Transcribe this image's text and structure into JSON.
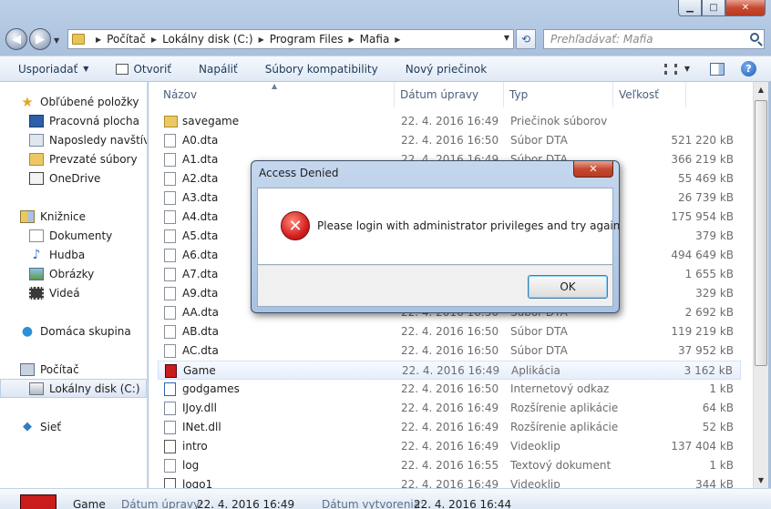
{
  "window": {
    "minimize": "▁",
    "maximize": "□",
    "close": "✕"
  },
  "address": {
    "crumbs": [
      "Počítač",
      "Lokálny disk (C:)",
      "Program Files",
      "Mafia"
    ],
    "search_placeholder": "Prehľadávať: Mafia"
  },
  "toolbar": {
    "organize": "Usporiadať",
    "open": "Otvoriť",
    "burn": "Napáliť",
    "compat": "Súbory kompatibility",
    "new_folder": "Nový priečinok"
  },
  "nav": {
    "favorites": "Obľúbené položky",
    "desktop": "Pracovná plocha",
    "recent": "Naposledy navštívené",
    "downloads": "Prevzaté súbory",
    "onedrive": "OneDrive",
    "libraries": "Knižnice",
    "documents": "Dokumenty",
    "music": "Hudba",
    "pictures": "Obrázky",
    "videos": "Videá",
    "homegroup": "Domáca skupina",
    "computer": "Počítač",
    "localdisk": "Lokálny disk (C:)",
    "network": "Sieť"
  },
  "columns": {
    "name": "Názov",
    "date": "Dátum úpravy",
    "type": "Typ",
    "size": "Veľkosť"
  },
  "files": [
    {
      "name": "savegame",
      "date": "22. 4. 2016 16:49",
      "type": "Priečinok súborov",
      "size": "",
      "icon": "folder"
    },
    {
      "name": "A0.dta",
      "date": "22. 4. 2016 16:50",
      "type": "Súbor DTA",
      "size": "521 220 kB",
      "icon": "dta"
    },
    {
      "name": "A1.dta",
      "date": "22. 4. 2016 16:49",
      "type": "Súbor DTA",
      "size": "366 219 kB",
      "icon": "dta"
    },
    {
      "name": "A2.dta",
      "date": "",
      "type": "",
      "size": "55 469 kB",
      "icon": "dta"
    },
    {
      "name": "A3.dta",
      "date": "",
      "type": "",
      "size": "26 739 kB",
      "icon": "dta"
    },
    {
      "name": "A4.dta",
      "date": "",
      "type": "",
      "size": "175 954 kB",
      "icon": "dta"
    },
    {
      "name": "A5.dta",
      "date": "",
      "type": "",
      "size": "379 kB",
      "icon": "dta"
    },
    {
      "name": "A6.dta",
      "date": "",
      "type": "",
      "size": "494 649 kB",
      "icon": "dta"
    },
    {
      "name": "A7.dta",
      "date": "",
      "type": "",
      "size": "1 655 kB",
      "icon": "dta"
    },
    {
      "name": "A9.dta",
      "date": "",
      "type": "",
      "size": "329 kB",
      "icon": "dta"
    },
    {
      "name": "AA.dta",
      "date": "22. 4. 2016 16:50",
      "type": "Súbor DTA",
      "size": "2 692 kB",
      "icon": "dta"
    },
    {
      "name": "AB.dta",
      "date": "22. 4. 2016 16:50",
      "type": "Súbor DTA",
      "size": "119 219 kB",
      "icon": "dta"
    },
    {
      "name": "AC.dta",
      "date": "22. 4. 2016 16:50",
      "type": "Súbor DTA",
      "size": "37 952 kB",
      "icon": "dta"
    },
    {
      "name": "Game",
      "date": "22. 4. 2016 16:49",
      "type": "Aplikácia",
      "size": "3 162 kB",
      "icon": "game"
    },
    {
      "name": "godgames",
      "date": "22. 4. 2016 16:50",
      "type": "Internetový odkaz",
      "size": "1 kB",
      "icon": "url"
    },
    {
      "name": "IJoy.dll",
      "date": "22. 4. 2016 16:49",
      "type": "Rozšírenie aplikácie",
      "size": "64 kB",
      "icon": "dll"
    },
    {
      "name": "INet.dll",
      "date": "22. 4. 2016 16:49",
      "type": "Rozšírenie aplikácie",
      "size": "52 kB",
      "icon": "dll"
    },
    {
      "name": "intro",
      "date": "22. 4. 2016 16:49",
      "type": "Videoklip",
      "size": "137 404 kB",
      "icon": "vid"
    },
    {
      "name": "log",
      "date": "22. 4. 2016 16:55",
      "type": "Textový dokument",
      "size": "1 kB",
      "icon": "txt"
    },
    {
      "name": "logo1",
      "date": "22. 4. 2016 16:49",
      "type": "Videoklip",
      "size": "344 kB",
      "icon": "vid"
    }
  ],
  "details": {
    "name": "Game",
    "modified_label": "Dátum úpravy:",
    "modified_value": "22. 4. 2016 16:49",
    "created_label": "Dátum vytvorenia:",
    "created_value": "22. 4. 2016 16:44"
  },
  "dialog": {
    "title": "Access Denied",
    "message": "Please login with administrator privileges and try again",
    "ok": "OK",
    "close": "✕"
  }
}
